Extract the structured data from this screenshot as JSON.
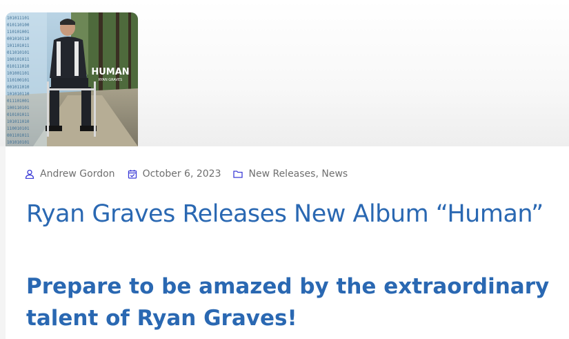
{
  "album": {
    "cover_title": "HUMAN",
    "cover_artist": "RYAN GRAVES"
  },
  "meta": {
    "author": "Andrew Gordon",
    "author_icon": "user-icon",
    "date": "October 6, 2023",
    "date_icon": "calendar-icon",
    "categories_icon": "folder-icon",
    "categories": [
      "New Releases",
      "News"
    ],
    "category_separator": ","
  },
  "post": {
    "title": "Ryan Graves Releases New Album “Human”",
    "subheading": "Prepare to be amazed by the extraordinary talent of Ryan Graves!"
  },
  "colors": {
    "heading": "#2a68b2",
    "meta_text": "#6f6f6f",
    "meta_icon": "#3b3bd6"
  }
}
